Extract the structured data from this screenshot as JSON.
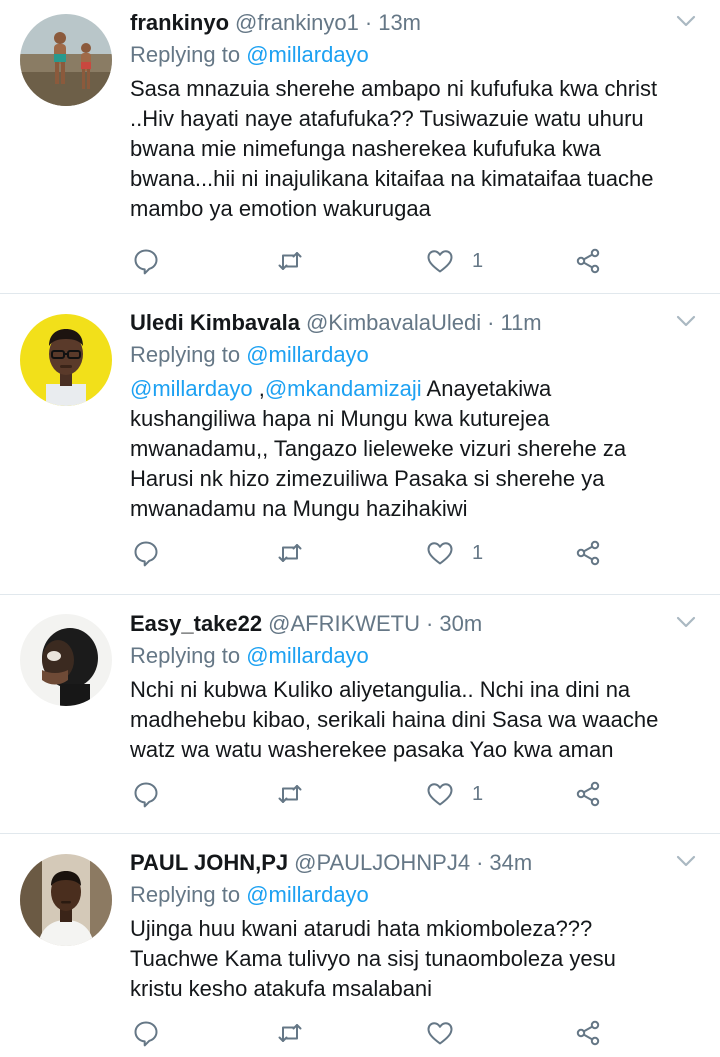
{
  "feed": {
    "tweets": [
      {
        "name": "frankinyo",
        "handle": "@frankinyo1",
        "separator": "·",
        "time": "13m",
        "replying_prefix": "Replying to",
        "replying_to": "@millardayo",
        "text_mentions": "",
        "text": "Sasa mnazuia sherehe ambapo ni kufufuka kwa christ\n..Hiv hayati naye atafufuka??  Tusiwazuie watu uhuru\nbwana mie nimefunga nasherekea kufufuka kwa\nbwana...hii ni inajulikana kitaifaa na kimataifaa tuache\nmambo ya emotion wakurugaa",
        "like_count": "1"
      },
      {
        "name": "Uledi Kimbavala",
        "handle": "@KimbavalaUledi",
        "separator": "·",
        "time": "11m",
        "replying_prefix": "Replying to",
        "replying_to": "@millardayo",
        "mention_1": "@millardayo",
        "mention_sep": " ,",
        "mention_2": "@mkandamizaji",
        "text": " Anayetakiwa\nkushangiliwa hapa ni Mungu kwa kuturejea\nmwanadamu,, Tangazo lieleweke vizuri sherehe za\nHarusi nk hizo zimezuiliwa Pasaka si sherehe ya\nmwanadamu na Mungu hazihakiwi",
        "like_count": "1"
      },
      {
        "name": "Easy_take22",
        "handle": "@AFRIKWETU",
        "separator": "·",
        "time": "30m",
        "replying_prefix": "Replying to",
        "replying_to": "@millardayo",
        "text": "Nchi ni kubwa Kuliko aliyetangulia.. Nchi ina dini na\nmadhehebu kibao, serikali haina dini Sasa wa waache\nwatz wa watu washerekee pasaka Yao kwa aman",
        "like_count": "1"
      },
      {
        "name": "PAUL JOHN,PJ",
        "handle": "@PAULJOHNPJ4",
        "separator": "·",
        "time": "34m",
        "replying_prefix": "Replying to",
        "replying_to": "@millardayo",
        "text": "Ujinga huu kwani atarudi hata mkiomboleza???\nTuachwe Kama tulivyo na sisj tunaomboleza yesu\nkristu kesho atakufa msalabani",
        "like_count": ""
      }
    ]
  },
  "colors": {
    "primary_text": "#14171a",
    "secondary_text": "#657786",
    "link": "#1da1f2",
    "divider": "#e1e8ed"
  },
  "icons": [
    "reply-icon",
    "retweet-icon",
    "like-icon",
    "share-icon",
    "chevron-down-icon"
  ]
}
